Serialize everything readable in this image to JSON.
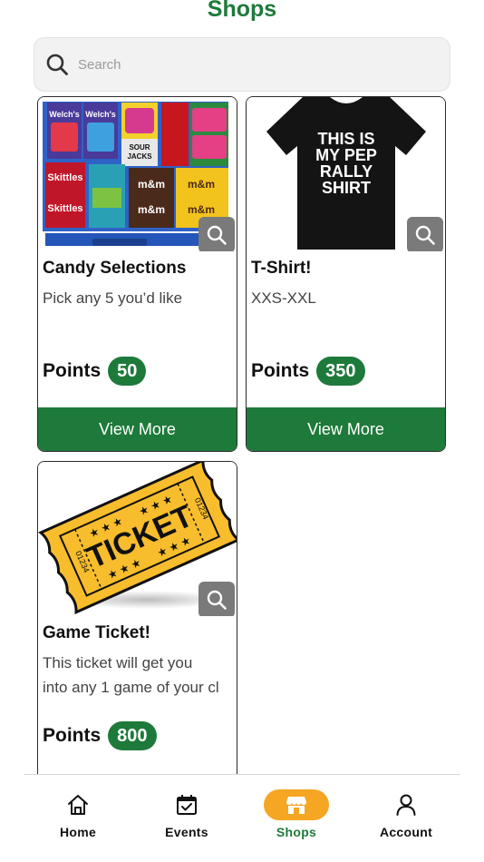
{
  "header": {
    "title": "Shops"
  },
  "search": {
    "placeholder": "Search",
    "icon": "search-icon"
  },
  "products": [
    {
      "name": "Candy Selections",
      "description": "Pick any 5 you’d like",
      "points_label": "Points",
      "points": "50",
      "cta": "View More"
    },
    {
      "name": "T-Shirt!",
      "description": "XXS-XXL",
      "points_label": "Points",
      "points": "350",
      "cta": "View More",
      "shirt_text": [
        "THIS IS",
        "MY PEP",
        "RALLY",
        "SHIRT"
      ]
    },
    {
      "name": "Game Ticket!",
      "description_lines": [
        "This ticket will get you",
        "into any 1 game of your cl"
      ],
      "points_label": "Points",
      "points": "800",
      "ticket_text": "TICKET",
      "ticket_number": "01234"
    }
  ],
  "candy_labels": [
    "Welch's",
    "Welch's",
    "Skittles",
    "Skittles",
    "SOUR",
    "JACKS",
    "m&m"
  ],
  "tabs": [
    {
      "label": "Home",
      "icon": "home-icon",
      "active": false
    },
    {
      "label": "Events",
      "icon": "calendar-check-icon",
      "active": false
    },
    {
      "label": "Shops",
      "icon": "store-icon",
      "active": true
    },
    {
      "label": "Account",
      "icon": "user-icon",
      "active": false
    }
  ],
  "colors": {
    "primary_green": "#1e7a3a",
    "accent_orange": "#f5a623",
    "zoom_gray": "#7a7a7a"
  }
}
